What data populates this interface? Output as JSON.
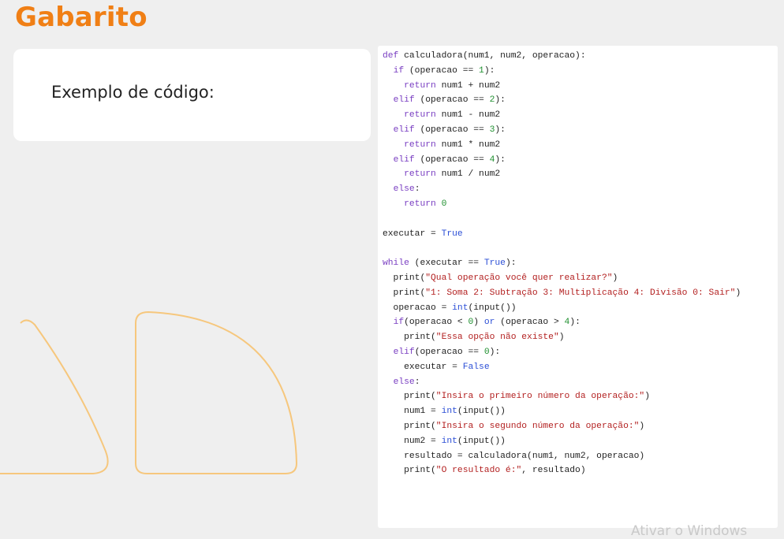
{
  "page": {
    "title": "Gabarito",
    "card_text": "Exemplo de código:",
    "watermark": "Ativar o Windows"
  },
  "colors": {
    "accent": "#f07f15",
    "shape_stroke": "#f6c77d",
    "keyword": "#7a3fc2",
    "builtin": "#2c4fd6",
    "number": "#209030",
    "string": "#b32121"
  },
  "code_lines": [
    [
      {
        "t": "def",
        "c": "kw"
      },
      {
        "t": " calculadora(num1, num2, operacao):"
      }
    ],
    [
      {
        "t": "  "
      },
      {
        "t": "if",
        "c": "kw"
      },
      {
        "t": " (operacao == "
      },
      {
        "t": "1",
        "c": "num"
      },
      {
        "t": "):"
      }
    ],
    [
      {
        "t": "    "
      },
      {
        "t": "return",
        "c": "kw"
      },
      {
        "t": " num1 + num2"
      }
    ],
    [
      {
        "t": "  "
      },
      {
        "t": "elif",
        "c": "kw"
      },
      {
        "t": " (operacao == "
      },
      {
        "t": "2",
        "c": "num"
      },
      {
        "t": "):"
      }
    ],
    [
      {
        "t": "    "
      },
      {
        "t": "return",
        "c": "kw"
      },
      {
        "t": " num1 - num2"
      }
    ],
    [
      {
        "t": "  "
      },
      {
        "t": "elif",
        "c": "kw"
      },
      {
        "t": " (operacao == "
      },
      {
        "t": "3",
        "c": "num"
      },
      {
        "t": "):"
      }
    ],
    [
      {
        "t": "    "
      },
      {
        "t": "return",
        "c": "kw"
      },
      {
        "t": " num1 * num2"
      }
    ],
    [
      {
        "t": "  "
      },
      {
        "t": "elif",
        "c": "kw"
      },
      {
        "t": " (operacao == "
      },
      {
        "t": "4",
        "c": "num"
      },
      {
        "t": "):"
      }
    ],
    [
      {
        "t": "    "
      },
      {
        "t": "return",
        "c": "kw"
      },
      {
        "t": " num1 / num2"
      }
    ],
    [
      {
        "t": "  "
      },
      {
        "t": "else",
        "c": "kw"
      },
      {
        "t": ":"
      }
    ],
    [
      {
        "t": "    "
      },
      {
        "t": "return",
        "c": "kw"
      },
      {
        "t": " "
      },
      {
        "t": "0",
        "c": "num"
      }
    ],
    [],
    [
      {
        "t": "executar = "
      },
      {
        "t": "True",
        "c": "bi"
      }
    ],
    [],
    [
      {
        "t": "while",
        "c": "kw"
      },
      {
        "t": " (executar == "
      },
      {
        "t": "True",
        "c": "bi"
      },
      {
        "t": "):"
      }
    ],
    [
      {
        "t": "  print("
      },
      {
        "t": "\"Qual operação você quer realizar?\"",
        "c": "str"
      },
      {
        "t": ")"
      }
    ],
    [
      {
        "t": "  print("
      },
      {
        "t": "\"1: Soma 2: Subtração 3: Multiplicação 4: Divisão 0: Sair\"",
        "c": "str"
      },
      {
        "t": ")"
      }
    ],
    [
      {
        "t": "  operacao = "
      },
      {
        "t": "int",
        "c": "bi"
      },
      {
        "t": "(input())"
      }
    ],
    [
      {
        "t": "  "
      },
      {
        "t": "if",
        "c": "kw"
      },
      {
        "t": "(operacao < "
      },
      {
        "t": "0",
        "c": "num"
      },
      {
        "t": ") "
      },
      {
        "t": "or",
        "c": "bi"
      },
      {
        "t": " (operacao > "
      },
      {
        "t": "4",
        "c": "num"
      },
      {
        "t": "):"
      }
    ],
    [
      {
        "t": "    print("
      },
      {
        "t": "\"Essa opção não existe\"",
        "c": "str"
      },
      {
        "t": ")"
      }
    ],
    [
      {
        "t": "  "
      },
      {
        "t": "elif",
        "c": "kw"
      },
      {
        "t": "(operacao == "
      },
      {
        "t": "0",
        "c": "num"
      },
      {
        "t": "):"
      }
    ],
    [
      {
        "t": "    executar = "
      },
      {
        "t": "False",
        "c": "bi"
      }
    ],
    [
      {
        "t": "  "
      },
      {
        "t": "else",
        "c": "kw"
      },
      {
        "t": ":"
      }
    ],
    [
      {
        "t": "    print("
      },
      {
        "t": "\"Insira o primeiro número da operação:\"",
        "c": "str"
      },
      {
        "t": ")"
      }
    ],
    [
      {
        "t": "    num1 = "
      },
      {
        "t": "int",
        "c": "bi"
      },
      {
        "t": "(input())"
      }
    ],
    [
      {
        "t": "    print("
      },
      {
        "t": "\"Insira o segundo número da operação:\"",
        "c": "str"
      },
      {
        "t": ")"
      }
    ],
    [
      {
        "t": "    num2 = "
      },
      {
        "t": "int",
        "c": "bi"
      },
      {
        "t": "(input())"
      }
    ],
    [
      {
        "t": "    resultado = calculadora(num1, num2, operacao)"
      }
    ],
    [
      {
        "t": "    print("
      },
      {
        "t": "\"O resultado é:\"",
        "c": "str"
      },
      {
        "t": ", resultado)"
      }
    ]
  ]
}
